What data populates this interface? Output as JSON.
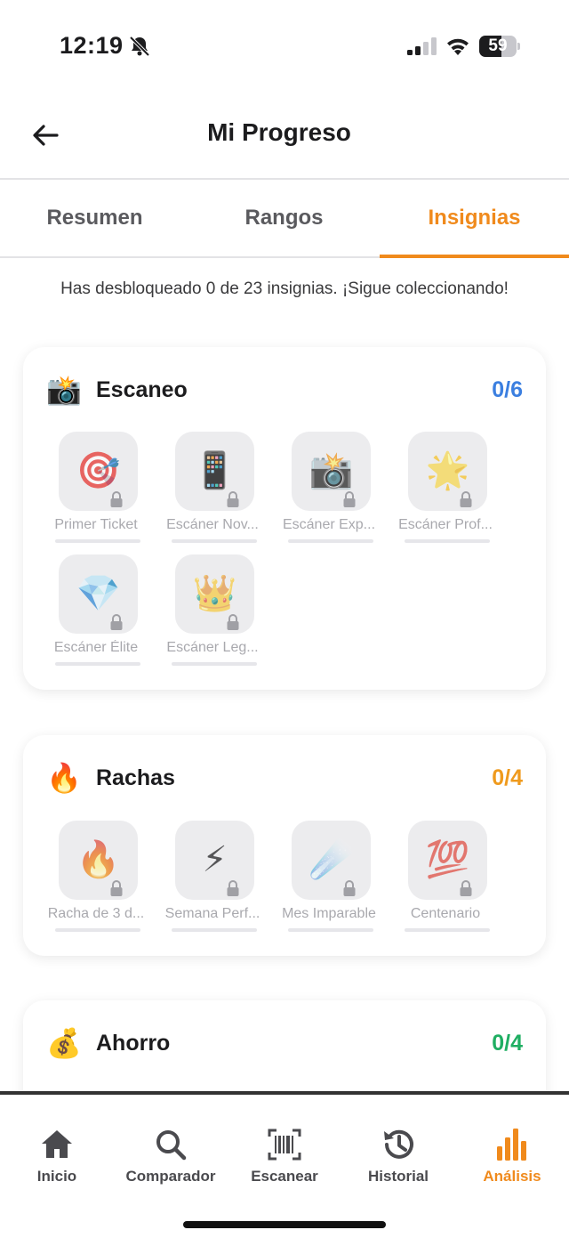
{
  "status_bar": {
    "time": "12:19",
    "battery": "59",
    "battery_level": 0.59
  },
  "header": {
    "title": "Mi Progreso"
  },
  "tabs": [
    {
      "label": "Resumen"
    },
    {
      "label": "Rangos"
    },
    {
      "label": "Insignias"
    }
  ],
  "active_tab": "Insignias",
  "summary": "Has desbloqueado 0 de 23 insignias. ¡Sigue coleccionando!",
  "categories": [
    {
      "icon": "📸",
      "title": "Escaneo",
      "count": "0/6",
      "color": "#3b7fe0",
      "badges": [
        {
          "emoji": "🎯",
          "name": "Primer Ticket",
          "progress": 0
        },
        {
          "emoji": "📱",
          "name": "Escáner Nov...",
          "progress": 0
        },
        {
          "emoji": "📸",
          "name": "Escáner Exp...",
          "progress": 0
        },
        {
          "emoji": "🌟",
          "name": "Escáner Prof...",
          "progress": 0
        },
        {
          "emoji": "💎",
          "name": "Escáner Élite",
          "progress": 0
        },
        {
          "emoji": "👑",
          "name": "Escáner Leg...",
          "progress": 0
        }
      ]
    },
    {
      "icon": "🔥",
      "title": "Rachas",
      "count": "0/4",
      "color": "#ef9a1d",
      "badges": [
        {
          "emoji": "🔥",
          "name": "Racha de 3 d...",
          "progress": 0
        },
        {
          "emoji": "⚡",
          "name": "Semana Perf...",
          "progress": 0
        },
        {
          "emoji": "☄️",
          "name": "Mes Imparable",
          "progress": 0
        },
        {
          "emoji": "💯",
          "name": "Centenario",
          "progress": 0
        }
      ]
    },
    {
      "icon": "💰",
      "title": "Ahorro",
      "count": "0/4",
      "color": "#1fae62",
      "badges": []
    }
  ],
  "bottom_nav": [
    {
      "label": "Inicio",
      "icon": "home-icon"
    },
    {
      "label": "Comparador",
      "icon": "search-icon"
    },
    {
      "label": "Escanear",
      "icon": "barcode-scan-icon"
    },
    {
      "label": "Historial",
      "icon": "history-icon"
    },
    {
      "label": "Análisis",
      "icon": "bar-chart-icon"
    }
  ],
  "colors": {
    "accent": "#f08a1c",
    "inactive_text": "#5a5a5e",
    "tile_bg": "#ececee"
  }
}
